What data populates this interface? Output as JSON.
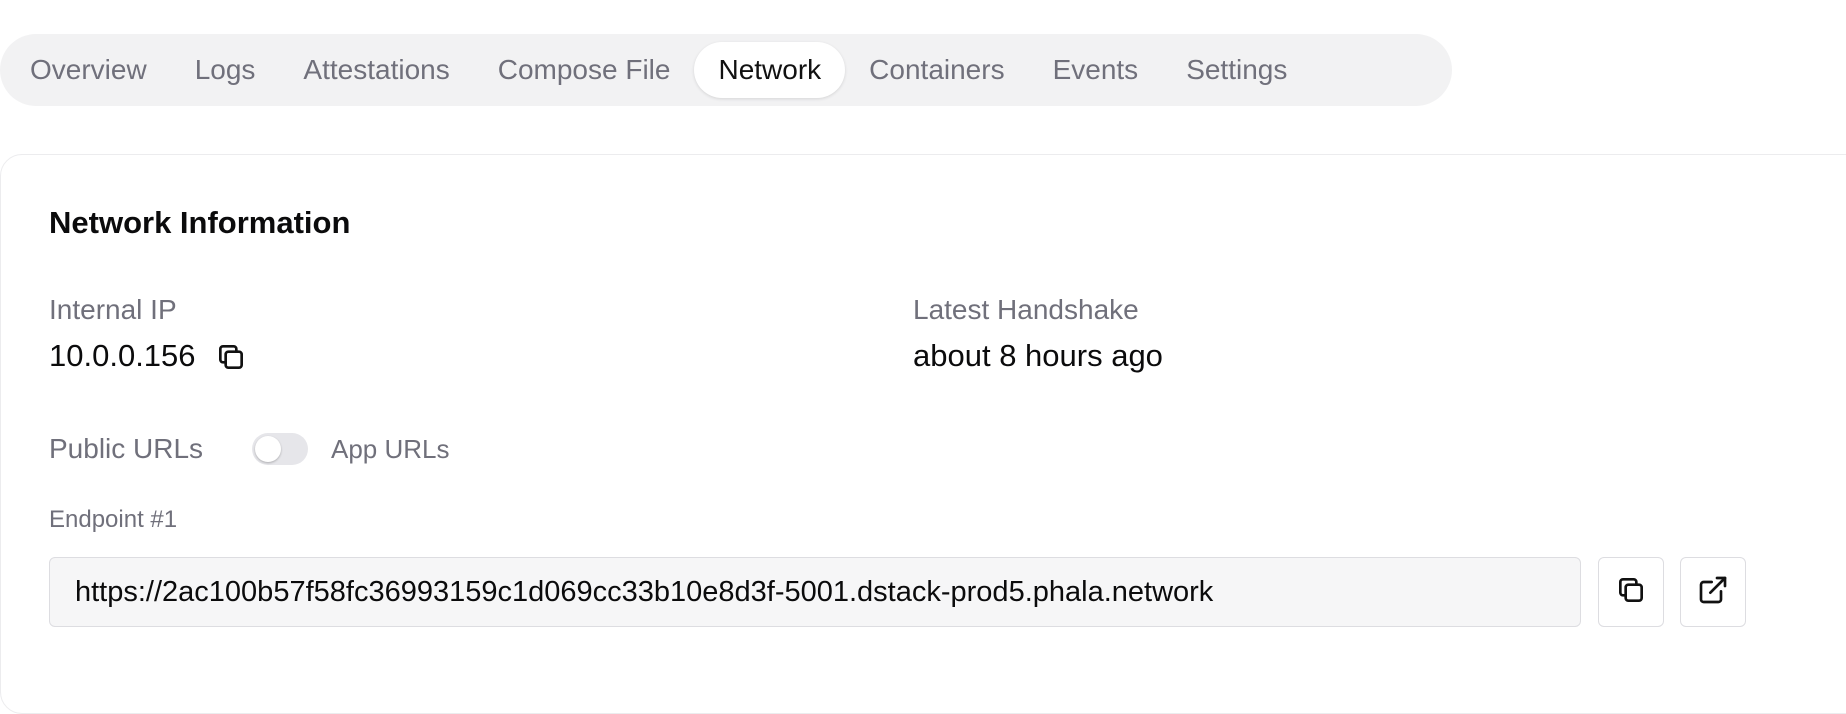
{
  "tabs": [
    {
      "label": "Overview",
      "active": false
    },
    {
      "label": "Logs",
      "active": false
    },
    {
      "label": "Attestations",
      "active": false
    },
    {
      "label": "Compose File",
      "active": false
    },
    {
      "label": "Network",
      "active": true
    },
    {
      "label": "Containers",
      "active": false
    },
    {
      "label": "Events",
      "active": false
    },
    {
      "label": "Settings",
      "active": false
    }
  ],
  "network": {
    "title": "Network Information",
    "internal_ip_label": "Internal IP",
    "internal_ip_value": "10.0.0.156",
    "handshake_label": "Latest Handshake",
    "handshake_value": "about 8 hours ago",
    "public_urls_label": "Public URLs",
    "toggle_label": "App URLs",
    "toggle_on": false,
    "endpoint_label": "Endpoint #1",
    "endpoint_url": "https://2ac100b57f58fc36993159c1d069cc33b10e8d3f-5001.dstack-prod5.phala.network"
  },
  "icons": {
    "copy": "copy-icon",
    "external_link": "external-link-icon"
  },
  "colors": {
    "muted_text": "#70707b",
    "tab_bar_bg": "#f2f2f3",
    "toggle_off_bg": "#e6e6ea"
  }
}
